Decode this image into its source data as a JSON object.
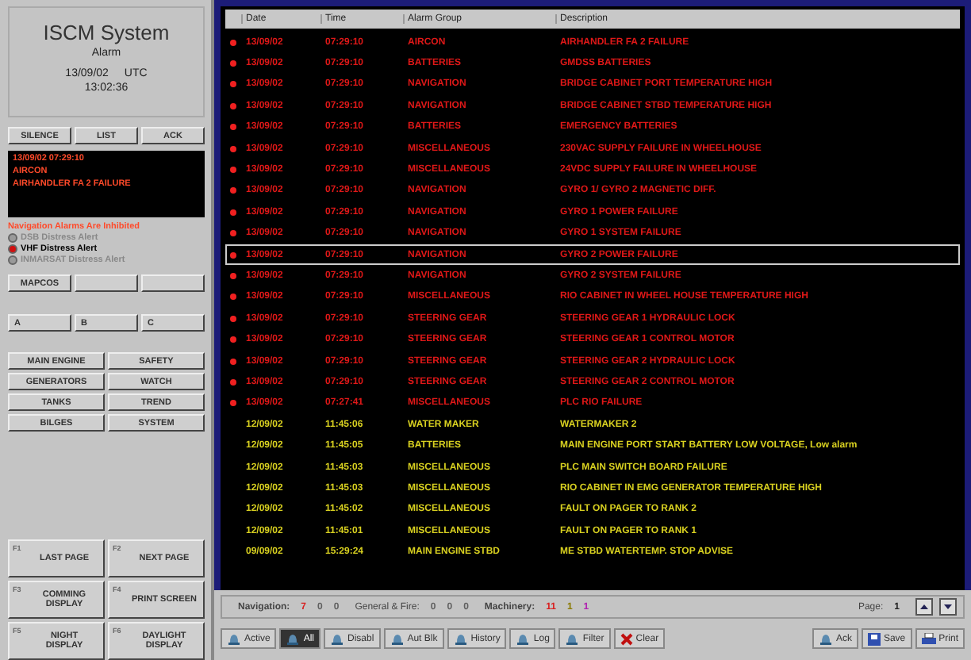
{
  "sidebar": {
    "title": "ISCM System",
    "subtitle": "Alarm",
    "date": "13/09/02",
    "zone": "UTC",
    "time": "13:02:36",
    "top_buttons": [
      "SILENCE",
      "LIST",
      "ACK"
    ],
    "alarm_box": [
      "13/09/02 07:29:10",
      "AIRCON",
      "AIRHANDLER FA 2 FAILURE"
    ],
    "inhibit_notice": "Navigation Alarms Are Inhibited",
    "distress": [
      {
        "label": "DSB Distress Alert",
        "on": false
      },
      {
        "label": "VHF Distress Alert",
        "on": true
      },
      {
        "label": "INMARSAT Distress Alert",
        "on": false
      }
    ],
    "mid_buttons": [
      "MAPCOS"
    ],
    "letter_buttons": [
      "A",
      "B",
      "C"
    ],
    "system_buttons": [
      "MAIN ENGINE",
      "SAFETY",
      "GENERATORS",
      "WATCH",
      "TANKS",
      "TREND",
      "BILGES",
      "SYSTEM"
    ],
    "function_keys": [
      {
        "key": "F1",
        "label": "LAST PAGE"
      },
      {
        "key": "F2",
        "label": "NEXT PAGE"
      },
      {
        "key": "F3",
        "label": "COMMING DISPLAY"
      },
      {
        "key": "F4",
        "label": "PRINT SCREEN"
      },
      {
        "key": "F5",
        "label": "NIGHT DISPLAY"
      },
      {
        "key": "F6",
        "label": "DAYLIGHT DISPLAY"
      }
    ]
  },
  "table": {
    "columns": [
      "Date",
      "Time",
      "Alarm Group",
      "Description"
    ],
    "rows": [
      {
        "date": "13/09/02",
        "time": "07:29:10",
        "group": "AIRCON",
        "description": "AIRHANDLER FA 2 FAILURE",
        "active": true,
        "selected": false
      },
      {
        "date": "13/09/02",
        "time": "07:29:10",
        "group": "BATTERIES",
        "description": "GMDSS BATTERIES",
        "active": true,
        "selected": false
      },
      {
        "date": "13/09/02",
        "time": "07:29:10",
        "group": "NAVIGATION",
        "description": "BRIDGE CABINET PORT TEMPERATURE HIGH",
        "active": true,
        "selected": false
      },
      {
        "date": "13/09/02",
        "time": "07:29:10",
        "group": "NAVIGATION",
        "description": "BRIDGE CABINET STBD TEMPERATURE HIGH",
        "active": true,
        "selected": false
      },
      {
        "date": "13/09/02",
        "time": "07:29:10",
        "group": "BATTERIES",
        "description": "EMERGENCY BATTERIES",
        "active": true,
        "selected": false
      },
      {
        "date": "13/09/02",
        "time": "07:29:10",
        "group": "MISCELLANEOUS",
        "description": "230VAC SUPPLY FAILURE IN WHEELHOUSE",
        "active": true,
        "selected": false
      },
      {
        "date": "13/09/02",
        "time": "07:29:10",
        "group": "MISCELLANEOUS",
        "description": "24VDC SUPPLY FAILURE IN WHEELHOUSE",
        "active": true,
        "selected": false
      },
      {
        "date": "13/09/02",
        "time": "07:29:10",
        "group": "NAVIGATION",
        "description": "GYRO 1/ GYRO 2 MAGNETIC DIFF.",
        "active": true,
        "selected": false
      },
      {
        "date": "13/09/02",
        "time": "07:29:10",
        "group": "NAVIGATION",
        "description": "GYRO 1 POWER FAILURE",
        "active": true,
        "selected": false
      },
      {
        "date": "13/09/02",
        "time": "07:29:10",
        "group": "NAVIGATION",
        "description": "GYRO 1 SYSTEM FAILURE",
        "active": true,
        "selected": false
      },
      {
        "date": "13/09/02",
        "time": "07:29:10",
        "group": "NAVIGATION",
        "description": "GYRO 2 POWER FAILURE",
        "active": true,
        "selected": true
      },
      {
        "date": "13/09/02",
        "time": "07:29:10",
        "group": "NAVIGATION",
        "description": "GYRO 2 SYSTEM FAILURE",
        "active": true,
        "selected": false
      },
      {
        "date": "13/09/02",
        "time": "07:29:10",
        "group": "MISCELLANEOUS",
        "description": "RIO CABINET IN WHEEL HOUSE TEMPERATURE HIGH",
        "active": true,
        "selected": false
      },
      {
        "date": "13/09/02",
        "time": "07:29:10",
        "group": "STEERING GEAR",
        "description": "STEERING GEAR 1 HYDRAULIC LOCK",
        "active": true,
        "selected": false
      },
      {
        "date": "13/09/02",
        "time": "07:29:10",
        "group": "STEERING GEAR",
        "description": "STEERING GEAR 1 CONTROL MOTOR",
        "active": true,
        "selected": false
      },
      {
        "date": "13/09/02",
        "time": "07:29:10",
        "group": "STEERING GEAR",
        "description": "STEERING GEAR 2 HYDRAULIC LOCK",
        "active": true,
        "selected": false
      },
      {
        "date": "13/09/02",
        "time": "07:29:10",
        "group": "STEERING GEAR",
        "description": "STEERING GEAR 2 CONTROL MOTOR",
        "active": true,
        "selected": false
      },
      {
        "date": "13/09/02",
        "time": "07:27:41",
        "group": "MISCELLANEOUS",
        "description": "PLC RIO FAILURE",
        "active": true,
        "selected": false
      },
      {
        "date": "12/09/02",
        "time": "11:45:06",
        "group": "WATER MAKER",
        "description": "WATERMAKER 2",
        "active": false,
        "selected": false
      },
      {
        "date": "12/09/02",
        "time": "11:45:05",
        "group": "BATTERIES",
        "description": "MAIN ENGINE PORT START BATTERY LOW VOLTAGE, Low alarm",
        "active": false,
        "selected": false
      },
      {
        "date": "12/09/02",
        "time": "11:45:03",
        "group": "MISCELLANEOUS",
        "description": "PLC MAIN SWITCH BOARD FAILURE",
        "active": false,
        "selected": false
      },
      {
        "date": "12/09/02",
        "time": "11:45:03",
        "group": "MISCELLANEOUS",
        "description": "RIO CABINET IN EMG GENERATOR TEMPERATURE HIGH",
        "active": false,
        "selected": false
      },
      {
        "date": "12/09/02",
        "time": "11:45:02",
        "group": "MISCELLANEOUS",
        "description": "FAULT ON PAGER TO RANK 2",
        "active": false,
        "selected": false
      },
      {
        "date": "12/09/02",
        "time": "11:45:01",
        "group": "MISCELLANEOUS",
        "description": "FAULT ON PAGER TO RANK 1",
        "active": false,
        "selected": false
      },
      {
        "date": "09/09/02",
        "time": "15:29:24",
        "group": "MAIN ENGINE STBD",
        "description": "ME STBD WATERTEMP. STOP ADVISE",
        "active": false,
        "selected": false
      }
    ]
  },
  "status_bar": {
    "groups": [
      {
        "label": "Navigation:",
        "counts": [
          {
            "text": "7",
            "color": "#d82020"
          },
          {
            "text": "0",
            "color": "#606060"
          },
          {
            "text": "0",
            "color": "#606060"
          }
        ]
      },
      {
        "label": "General & Fire:",
        "counts": [
          {
            "text": "0",
            "color": "#606060"
          },
          {
            "text": "0",
            "color": "#606060"
          },
          {
            "text": "0",
            "color": "#606060"
          }
        ]
      },
      {
        "label": "Machinery:",
        "counts": [
          {
            "text": "11",
            "color": "#d82020"
          },
          {
            "text": "1",
            "color": "#8a7a00"
          },
          {
            "text": "1",
            "color": "#b020b0"
          }
        ]
      }
    ],
    "page_label": "Page:",
    "page": "1"
  },
  "toolbar": [
    {
      "label": "Active",
      "kind": "bell",
      "selected": false
    },
    {
      "label": "All",
      "kind": "bell",
      "selected": true
    },
    {
      "label": "Disabl",
      "kind": "bell",
      "selected": false
    },
    {
      "label": "Aut Blk",
      "kind": "bell",
      "selected": false
    },
    {
      "label": "History",
      "kind": "bell",
      "selected": false
    },
    {
      "label": "Log",
      "kind": "bell",
      "selected": false
    },
    {
      "label": "Filter",
      "kind": "bell",
      "selected": false
    },
    {
      "label": "Clear",
      "kind": "clear",
      "selected": false
    },
    {
      "label": "Ack",
      "kind": "bell",
      "selected": false
    },
    {
      "label": "Save",
      "kind": "disk",
      "selected": false
    },
    {
      "label": "Print",
      "kind": "printer",
      "selected": false
    }
  ]
}
